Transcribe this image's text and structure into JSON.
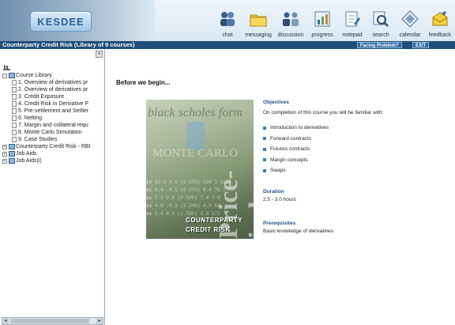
{
  "header": {
    "logo_text": "KESDEE",
    "tools": [
      {
        "label": "chat",
        "icon": "chat-icon"
      },
      {
        "label": "messaging",
        "icon": "messaging-icon"
      },
      {
        "label": "discussion",
        "icon": "discussion-icon"
      },
      {
        "label": "progress",
        "icon": "progress-icon"
      },
      {
        "label": "notepad",
        "icon": "notepad-icon"
      },
      {
        "label": "search",
        "icon": "search-icon"
      },
      {
        "label": "calendar",
        "icon": "calendar-icon"
      },
      {
        "label": "feedback",
        "icon": "feedback-icon"
      }
    ]
  },
  "titlebar": {
    "course_title": "Counterparty Credit Risk (Library of 9 courses)",
    "facing_problem": "Facing Problem?",
    "exit": "EXIT"
  },
  "sidebar": {
    "close": "×",
    "root": {
      "label": "Course Library",
      "toggle": "-"
    },
    "items": [
      {
        "label": "1. Overview of derivatives pr"
      },
      {
        "label": "2. Overview of derivatives pr"
      },
      {
        "label": "3. Credit Exposure"
      },
      {
        "label": "4. Credit Risk in Derivative P"
      },
      {
        "label": "5. Pre-settlement and Settler"
      },
      {
        "label": "6. Netting"
      },
      {
        "label": "7. Margin and collateral requ"
      },
      {
        "label": "8. Monte Carlo Simulation"
      },
      {
        "label": "9. Case Studies"
      }
    ],
    "collapsed": [
      {
        "label": "Counterparty Credit Risk - RBI",
        "toggle": "+"
      },
      {
        "label": "Job Aids",
        "toggle": "+"
      },
      {
        "label": "Job Aids(i)",
        "toggle": "+"
      }
    ],
    "scroll_left": "◂",
    "scroll_right": "▸"
  },
  "main": {
    "heading": "Before we begin...",
    "hero": {
      "bg_text1": "black scholes form",
      "bg_text2": "MONTE CARLO",
      "bg_text3": "Price-index",
      "caption1": "COUNTERPARTY",
      "caption2": "CREDIT RISK"
    },
    "objectives": {
      "title": "Objectives",
      "intro": "On completion of this course you will be familiar with:",
      "items": [
        "Introduction to derivatives",
        "Forward contracts",
        "Futures contracts",
        "Margin concepts",
        "Swaps"
      ]
    },
    "duration": {
      "title": "Duration",
      "value": "2.5 - 3.0 hours"
    },
    "prerequisites": {
      "title": "Prerequisites",
      "value": "Basic knowledge of derivatives"
    }
  }
}
